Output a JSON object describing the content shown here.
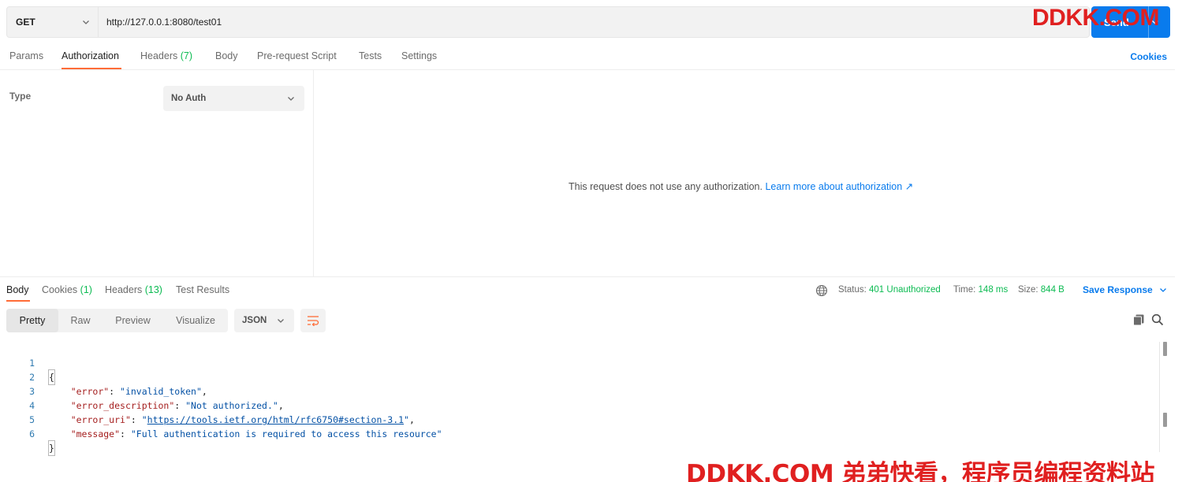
{
  "request": {
    "method": "GET",
    "url": "http://127.0.0.1:8080/test01",
    "send_label": "Send"
  },
  "watermark": {
    "top": "DDKK.COM",
    "bottom": "DDKK.COM 弟弟快看，程序员编程资料站"
  },
  "request_tabs": [
    {
      "label": "Params"
    },
    {
      "label": "Authorization",
      "active": true
    },
    {
      "label": "Headers",
      "count": "(7)"
    },
    {
      "label": "Body"
    },
    {
      "label": "Pre-request Script"
    },
    {
      "label": "Tests"
    },
    {
      "label": "Settings"
    }
  ],
  "cookies_label": "Cookies",
  "auth": {
    "type_label": "Type",
    "type_value": "No Auth",
    "message": "This request does not use any authorization.",
    "learn_more": "Learn more about authorization ↗"
  },
  "response_tabs": [
    {
      "label": "Body",
      "active": true
    },
    {
      "label": "Cookies",
      "count": "(1)"
    },
    {
      "label": "Headers",
      "count": "(13)"
    },
    {
      "label": "Test Results"
    }
  ],
  "response_meta": {
    "status_label": "Status:",
    "status_value": "401 Unauthorized",
    "time_label": "Time:",
    "time_value": "148 ms",
    "size_label": "Size:",
    "size_value": "844 B",
    "save_label": "Save Response"
  },
  "view_modes": [
    "Pretty",
    "Raw",
    "Preview",
    "Visualize"
  ],
  "format": "JSON",
  "body_lines": [
    {
      "n": "1",
      "open": "{"
    },
    {
      "n": "2",
      "key": "\"error\"",
      "sep": ": ",
      "value": "\"invalid_token\"",
      "end": ","
    },
    {
      "n": "3",
      "key": "\"error_description\"",
      "sep": ": ",
      "value": "\"Not authorized.\"",
      "end": ","
    },
    {
      "n": "4",
      "key": "\"error_uri\"",
      "sep": ": ",
      "q1": "\"",
      "link": "https://tools.ietf.org/html/rfc6750#section-3.1",
      "q2": "\"",
      "end": ","
    },
    {
      "n": "5",
      "key": "\"message\"",
      "sep": ": ",
      "value": "\"Full authentication is required to access this resource\"",
      "end": ""
    },
    {
      "n": "6",
      "close": "}"
    }
  ],
  "colors": {
    "accent": "#ff6c37",
    "primary": "#097bed",
    "success": "#0cbb52",
    "watermark": "#e02020"
  }
}
